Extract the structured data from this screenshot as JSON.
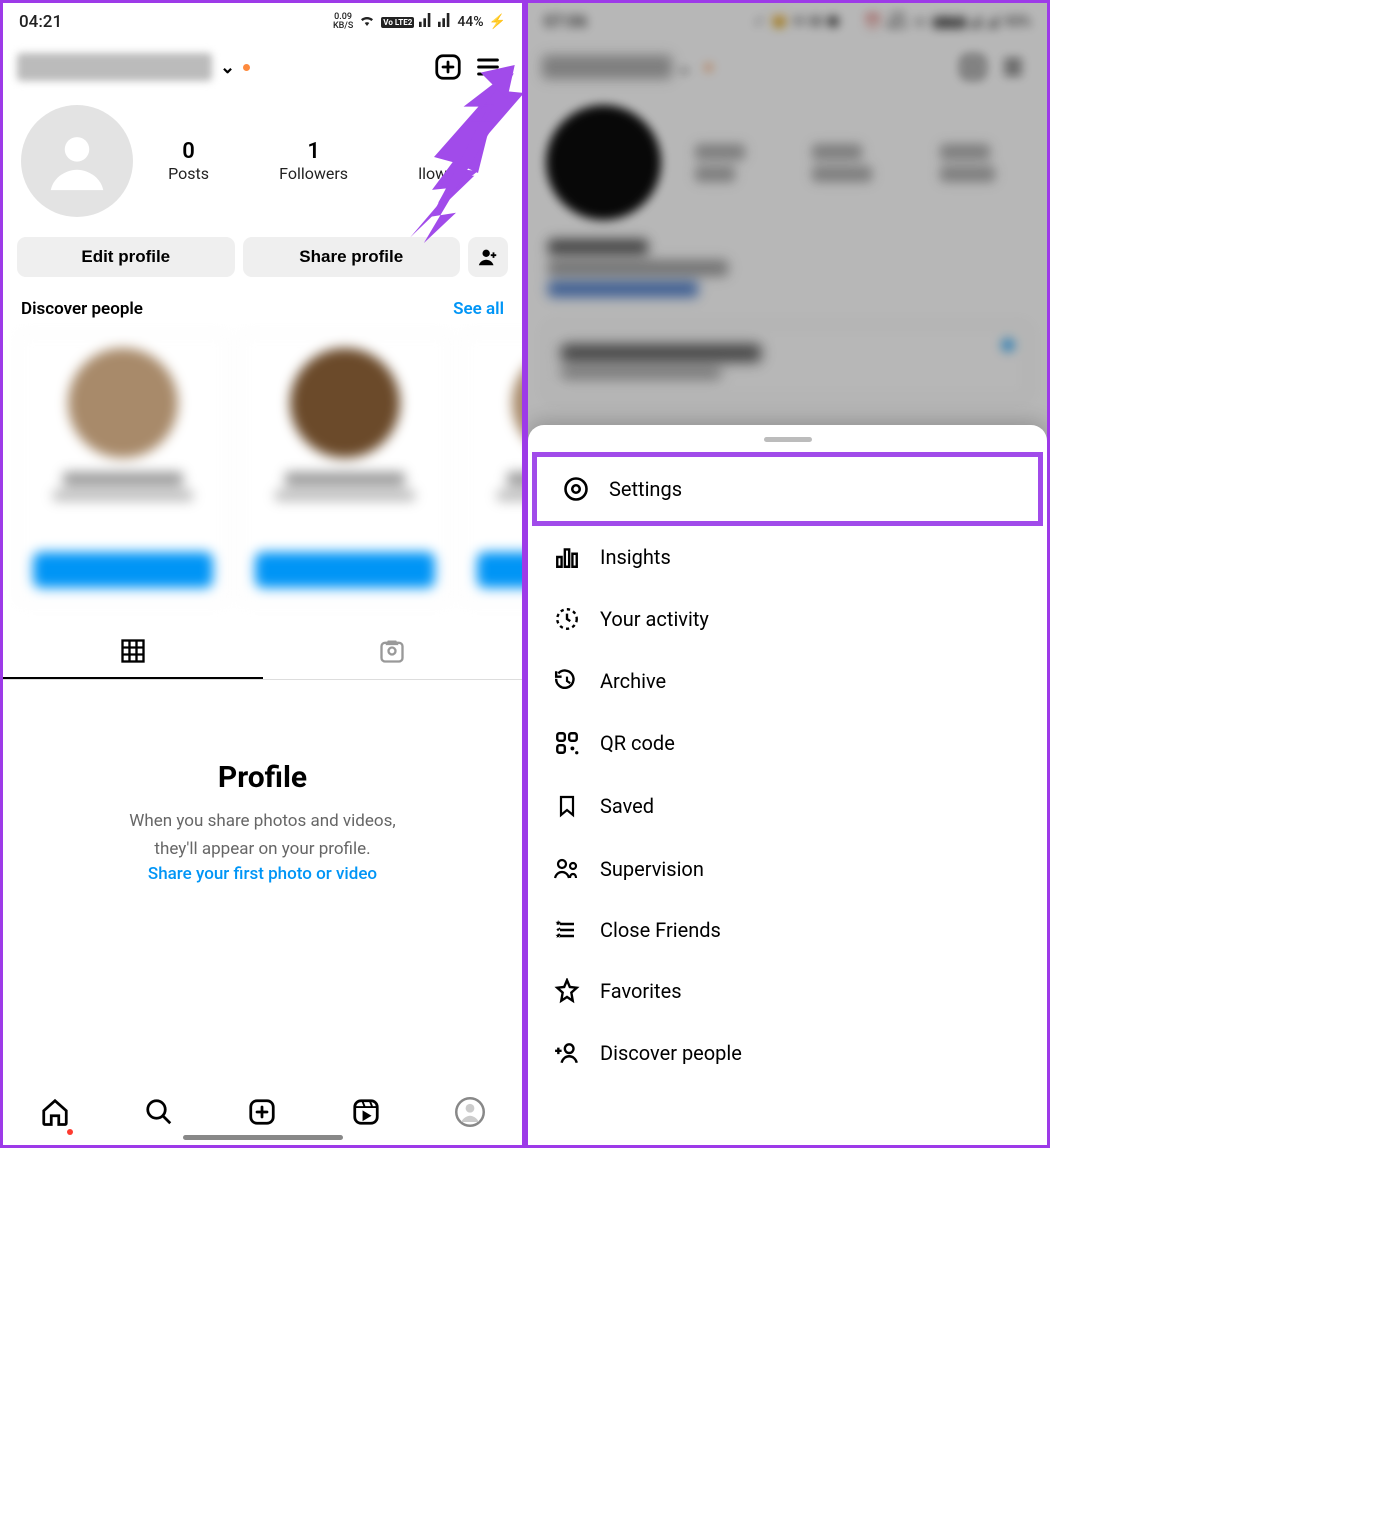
{
  "left": {
    "status": {
      "time": "04:21",
      "kbs_top": "0.09",
      "kbs_bot": "KB/S",
      "lte": "Vo LTE2",
      "battery": "44%",
      "charging": "⚡"
    },
    "header": {
      "chevron": "⌄",
      "notif_color": "#fe8a3d"
    },
    "stats": {
      "posts_val": "0",
      "posts_label": "Posts",
      "followers_val": "1",
      "followers_label": "Followers",
      "following_label_visible": "llowing"
    },
    "buttons": {
      "edit": "Edit profile",
      "share": "Share profile"
    },
    "discover": {
      "title": "Discover people",
      "see_all": "See all"
    },
    "empty": {
      "title": "Profile",
      "sub1": "When you share photos and videos,",
      "sub2": "they'll appear on your profile.",
      "link": "Share your first photo or video"
    },
    "tabs": {
      "grid": "grid-icon",
      "tagged": "tagged-icon"
    },
    "arrow_color": "#a14bea"
  },
  "right": {
    "status": {
      "time": "07:06",
      "kbs_top": "109",
      "kbs_bot": "KB/S",
      "lte": "Vo LTE2",
      "battery": "93%"
    },
    "menu": {
      "items": [
        {
          "id": "settings",
          "label": "Settings",
          "highlighted": true
        },
        {
          "id": "insights",
          "label": "Insights"
        },
        {
          "id": "your-activity",
          "label": "Your activity"
        },
        {
          "id": "archive",
          "label": "Archive"
        },
        {
          "id": "qr-code",
          "label": "QR code"
        },
        {
          "id": "saved",
          "label": "Saved"
        },
        {
          "id": "supervision",
          "label": "Supervision"
        },
        {
          "id": "close-friends",
          "label": "Close Friends"
        },
        {
          "id": "favorites",
          "label": "Favorites"
        },
        {
          "id": "discover-people",
          "label": "Discover people"
        }
      ]
    }
  },
  "colors": {
    "accent": "#0095f6",
    "annotation": "#a14bea"
  }
}
